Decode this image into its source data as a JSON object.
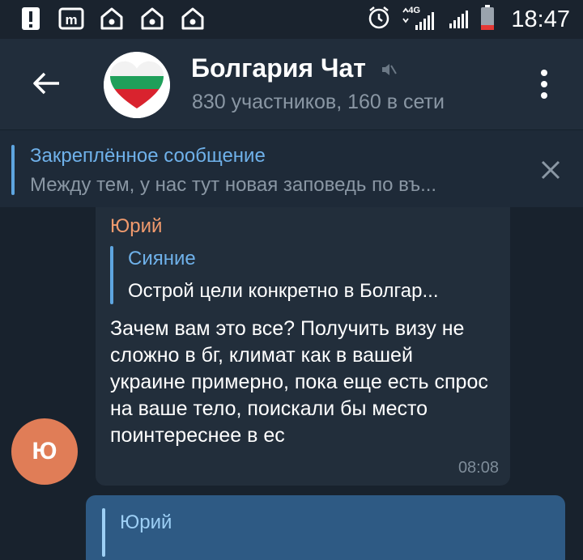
{
  "status_bar": {
    "time": "18:47",
    "network": "4G",
    "icons": [
      "alert-icon",
      "m-app-icon",
      "home-icon",
      "home-icon",
      "home-icon"
    ]
  },
  "header": {
    "title": "Болгария Чат",
    "subtitle": "830 участников, 160 в сети"
  },
  "pinned": {
    "title": "Закреплённое сообщение",
    "text": "Между тем, у нас тут новая заповедь по въ..."
  },
  "message": {
    "sender": "Юрий",
    "reply_name": "Сияние",
    "reply_text": "Острой цели конкретно в Болгар...",
    "text": "Зачем вам это все? Получить визу не сложно в бг, климат как в вашей украине примерно, пока еще есть спрос на ваше тело, поискали бы место поинтереснее в ес",
    "time": "08:08",
    "avatar_letter": "Ю"
  },
  "outgoing": {
    "reply_name": "Юрий"
  },
  "colors": {
    "background": "#18222d",
    "header": "#212d3b",
    "accent": "#6fb1ea",
    "sender_name": "#f09a6d",
    "avatar": "#e07d57",
    "outgoing_bubble": "#2e5a84"
  }
}
